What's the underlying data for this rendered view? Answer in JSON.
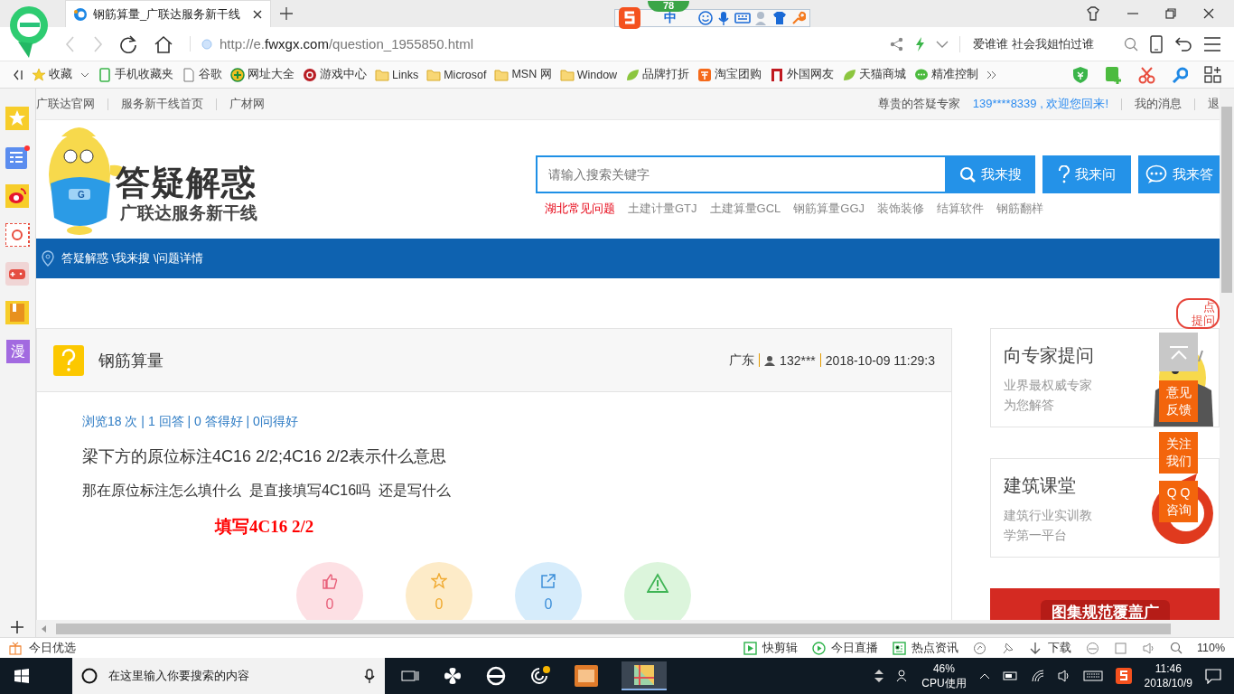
{
  "browser": {
    "tab_title": "钢筋算量_广联达服务新干线",
    "ime": {
      "badge": "78",
      "mode": "中"
    },
    "url": {
      "scheme": "http://e.",
      "domain": "fwxgx.com",
      "path": "/question_1955850.html"
    },
    "search_text": "爱谁谁 社会我姐怕过谁",
    "bookmarks": [
      {
        "label": "收藏",
        "kind": "star"
      },
      {
        "label": "手机收藏夹",
        "kind": "phone"
      },
      {
        "label": "谷歌",
        "kind": "page"
      },
      {
        "label": "网址大全",
        "kind": "globe"
      },
      {
        "label": "游戏中心",
        "kind": "game"
      },
      {
        "label": "Links",
        "kind": "folder"
      },
      {
        "label": "Microsof",
        "kind": "folder"
      },
      {
        "label": "MSN 网",
        "kind": "folder"
      },
      {
        "label": "Window",
        "kind": "folder"
      },
      {
        "label": "品牌打折",
        "kind": "leaf"
      },
      {
        "label": "淘宝团购",
        "kind": "taobao"
      },
      {
        "label": "外国网友",
        "kind": "flag"
      },
      {
        "label": "天猫商城",
        "kind": "leaf"
      },
      {
        "label": "精准控制",
        "kind": "chat"
      }
    ]
  },
  "sidebar": {
    "items": [
      {
        "kind": "star"
      },
      {
        "kind": "news",
        "badge": true
      },
      {
        "kind": "weibo"
      },
      {
        "kind": "mail"
      },
      {
        "kind": "game"
      },
      {
        "kind": "book"
      },
      {
        "kind": "comic",
        "label": "漫"
      }
    ]
  },
  "site_nav": {
    "links": [
      "广联达官网",
      "服务新干线首页",
      "广材网"
    ],
    "greeting": "尊贵的答疑专家",
    "user": "139****8339 , 欢迎您回来!",
    "links_right": [
      "我的消息",
      "退"
    ]
  },
  "logo": {
    "title": "答疑解惑",
    "subtitle": "广联达服务新干线",
    "badge": "G"
  },
  "search": {
    "placeholder": "请输入搜索关键字",
    "buttons": [
      {
        "label": "我来搜",
        "kind": "search"
      },
      {
        "label": "我来问",
        "kind": "ask"
      },
      {
        "label": "我来答",
        "kind": "answer"
      }
    ],
    "tags": [
      {
        "label": "湖北常见问题",
        "highlighted": true
      },
      {
        "label": "土建计量GTJ",
        "highlighted": false
      },
      {
        "label": "土建算量GCL",
        "highlighted": false
      },
      {
        "label": "钢筋算量GGJ",
        "highlighted": false
      },
      {
        "label": "装饰装修",
        "highlighted": false
      },
      {
        "label": "结算软件",
        "highlighted": false
      },
      {
        "label": "钢筋翻样",
        "highlighted": false
      }
    ]
  },
  "breadcrumb": "答疑解惑 \\我来搜 \\问题详情",
  "question": {
    "category": "钢筋算量",
    "location": "广东",
    "user": "132***",
    "time": "2018-10-09 11:29:3",
    "stats": "浏览18 次 | 1 回答 | 0 答得好 | 0问得好",
    "title": "梁下方的原位标注4C16 2/2;4C16 2/2表示什么意思",
    "body": "那在原位标注怎么填什么  是直接填写4C16吗  还是写什么",
    "answer": "填写**4C16 2/2**",
    "actions": [
      {
        "kind": "like",
        "count": "0",
        "color": "#fde0e4"
      },
      {
        "kind": "favorite",
        "count": "0",
        "color": "#fdebc8"
      },
      {
        "kind": "share",
        "count": "0",
        "color": "#d6ecfb"
      },
      {
        "kind": "report",
        "color": "#dcf5dc"
      }
    ]
  },
  "side_cards": [
    {
      "title": "向专家提问",
      "desc": "业界最权威专家为您解答",
      "kind": "mascot"
    },
    {
      "title": "建筑课堂",
      "desc": "建筑行业实训教学第一平台",
      "kind": "ring"
    }
  ],
  "banner": "图集规范覆盖广",
  "float": {
    "ask": [
      "点",
      "提问"
    ],
    "buttons": [
      "意见反馈",
      "关注我们",
      "Q Q咨询"
    ]
  },
  "status_bar": {
    "left": "今日优选",
    "items": [
      {
        "label": "快剪辑",
        "kind": "play"
      },
      {
        "label": "今日直播",
        "kind": "live"
      },
      {
        "label": "热点资讯",
        "kind": "news"
      },
      {
        "label": "下载",
        "kind": "download"
      }
    ],
    "zoom": "110%"
  },
  "taskbar": {
    "search_placeholder": "在这里输入你要搜索的内容",
    "cpu": "46%",
    "cpu_label": "CPU使用",
    "time": "11:46",
    "date": "2018/10/9"
  }
}
